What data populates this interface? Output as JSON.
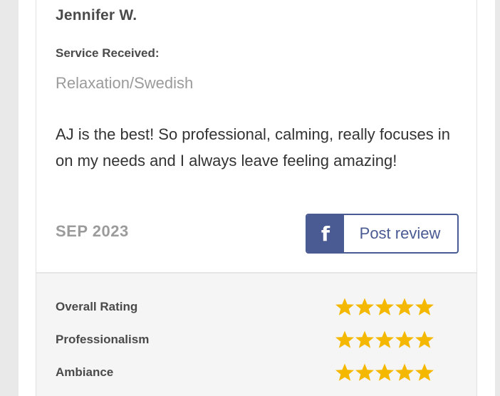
{
  "review": {
    "reviewer_name": "Jennifer W.",
    "service_label": "Service Received:",
    "service_value": "Relaxation/Swedish",
    "text": "AJ is the best! So professional, calming, really focuses in on my needs and I always leave feeling amazing!",
    "date": "SEP 2023"
  },
  "actions": {
    "post_review_label": "Post review",
    "facebook_glyph": "f",
    "facebook_icon": "facebook-icon"
  },
  "ratings": [
    {
      "label": "Overall Rating",
      "stars": 5,
      "max": 5
    },
    {
      "label": "Professionalism",
      "stars": 5,
      "max": 5
    },
    {
      "label": "Ambiance",
      "stars": 5,
      "max": 5
    }
  ],
  "colors": {
    "star": "#f5b800",
    "facebook": "#4a5a92",
    "name": "#4a4a4a",
    "muted": "#9b9b9b"
  }
}
